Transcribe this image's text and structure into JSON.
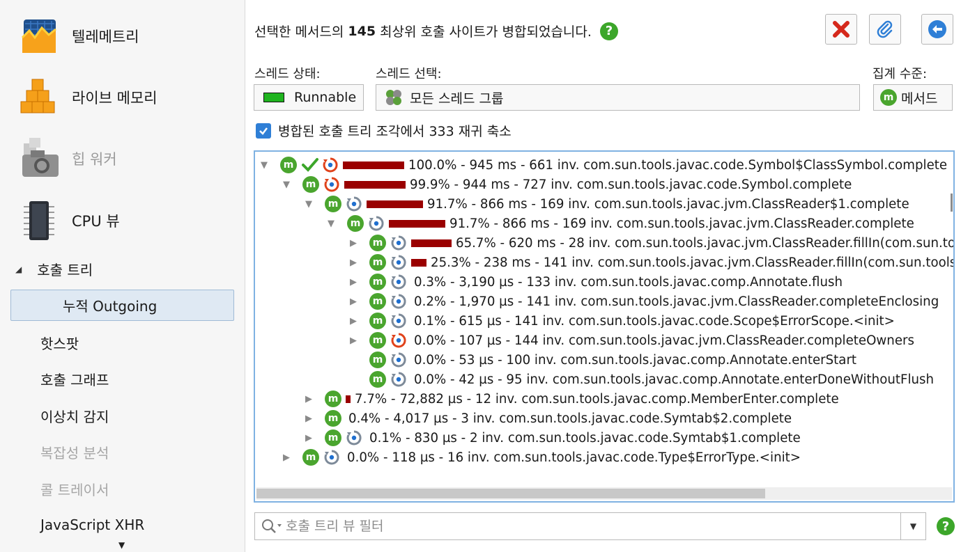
{
  "sidebar": {
    "big_items": [
      {
        "label": "텔레메트리",
        "icon": "telemetry-icon",
        "enabled": true
      },
      {
        "label": "라이브 메모리",
        "icon": "live-memory-icon",
        "enabled": true
      },
      {
        "label": "힙 워커",
        "icon": "heap-walker-icon",
        "enabled": false
      },
      {
        "label": "CPU 뷰",
        "icon": "cpu-view-icon",
        "enabled": true
      }
    ],
    "section": "호출 트리",
    "selected_sub": "누적 Outgoing",
    "items": [
      {
        "label": "핫스팟",
        "enabled": true
      },
      {
        "label": "호출 그래프",
        "enabled": true
      },
      {
        "label": "이상치 감지",
        "enabled": true
      },
      {
        "label": "복잡성 분석",
        "enabled": false
      },
      {
        "label": "콜 트레이서",
        "enabled": false
      },
      {
        "label": "JavaScript XHR",
        "enabled": true
      }
    ]
  },
  "header": {
    "message_before": "선택한 메서드의",
    "message_count": "145",
    "message_after": "최상위 호출 사이트가 병합되었습니다.",
    "help": "?"
  },
  "controls": {
    "thread_state_label": "스레드 상태:",
    "thread_state_value": "Runnable",
    "thread_select_label": "스레드 선택:",
    "thread_select_value": "모든 스레드 그룹",
    "aggregation_label": "집계 수준:",
    "aggregation_value": "메서드",
    "merge_checkbox_label": "병합된 호출 트리 조각에서 333 재귀 축소",
    "merge_checked": true
  },
  "tree": [
    {
      "depth": 0,
      "toggle": "expanded",
      "status": "check",
      "timer": "red",
      "pct": 100.0,
      "text": "100.0% - 945 ms - 661 inv. com.sun.tools.javac.code.Symbol$ClassSymbol.complete"
    },
    {
      "depth": 1,
      "toggle": "expanded",
      "status": "",
      "timer": "red",
      "pct": 99.9,
      "text": "99.9% - 944 ms - 727 inv. com.sun.tools.javac.code.Symbol.complete"
    },
    {
      "depth": 2,
      "toggle": "expanded",
      "status": "",
      "timer": "gray",
      "pct": 91.7,
      "text": "91.7% - 866 ms - 169 inv. com.sun.tools.javac.jvm.ClassReader$1.complete"
    },
    {
      "depth": 3,
      "toggle": "expanded",
      "status": "",
      "timer": "gray",
      "pct": 91.7,
      "text": "91.7% - 866 ms - 169 inv. com.sun.tools.javac.jvm.ClassReader.complete"
    },
    {
      "depth": 4,
      "toggle": "collapsed",
      "status": "",
      "timer": "gray",
      "pct": 65.7,
      "text": "65.7% - 620 ms - 28 inv. com.sun.tools.javac.jvm.ClassReader.fillIn(com.sun.too"
    },
    {
      "depth": 4,
      "toggle": "collapsed",
      "status": "",
      "timer": "gray",
      "pct": 25.3,
      "text": "25.3% - 238 ms - 141 inv. com.sun.tools.javac.jvm.ClassReader.fillIn(com.sun.tools"
    },
    {
      "depth": 4,
      "toggle": "collapsed",
      "status": "",
      "timer": "gray",
      "pct": 0.3,
      "text": "0.3% - 3,190 µs - 133 inv. com.sun.tools.javac.comp.Annotate.flush"
    },
    {
      "depth": 4,
      "toggle": "collapsed",
      "status": "",
      "timer": "gray",
      "pct": 0.2,
      "text": "0.2% - 1,970 µs - 141 inv. com.sun.tools.javac.jvm.ClassReader.completeEnclosing"
    },
    {
      "depth": 4,
      "toggle": "collapsed",
      "status": "",
      "timer": "gray",
      "pct": 0.1,
      "text": "0.1% - 615 µs - 141 inv. com.sun.tools.javac.code.Scope$ErrorScope.<init>"
    },
    {
      "depth": 4,
      "toggle": "collapsed",
      "status": "",
      "timer": "red",
      "pct": 0.0,
      "text": "0.0% - 107 µs - 144 inv. com.sun.tools.javac.jvm.ClassReader.completeOwners"
    },
    {
      "depth": 4,
      "toggle": "none",
      "status": "",
      "timer": "gray",
      "pct": 0.0,
      "text": "0.0% - 53 µs - 100 inv. com.sun.tools.javac.comp.Annotate.enterStart"
    },
    {
      "depth": 4,
      "toggle": "none",
      "status": "",
      "timer": "gray",
      "pct": 0.0,
      "text": "0.0% - 42 µs - 95 inv. com.sun.tools.javac.comp.Annotate.enterDoneWithoutFlush"
    },
    {
      "depth": 2,
      "toggle": "collapsed",
      "status": "",
      "timer": "",
      "pct": 7.7,
      "text": "7.7% - 72,882 µs - 12 inv. com.sun.tools.javac.comp.MemberEnter.complete"
    },
    {
      "depth": 2,
      "toggle": "collapsed",
      "status": "",
      "timer": "",
      "pct": 0.4,
      "text": "0.4% - 4,017 µs - 3 inv. com.sun.tools.javac.code.Symtab$2.complete"
    },
    {
      "depth": 2,
      "toggle": "collapsed",
      "status": "",
      "timer": "gray",
      "pct": 0.1,
      "text": "0.1% - 830 µs - 2 inv. com.sun.tools.javac.code.Symtab$1.complete"
    },
    {
      "depth": 1,
      "toggle": "collapsed",
      "status": "",
      "timer": "gray",
      "pct": 0.0,
      "text": "0.0% - 118 µs - 16 inv. com.sun.tools.javac.code.Type$ErrorType.<init>"
    }
  ],
  "filter": {
    "placeholder": "호출 트리 뷰 필터"
  },
  "colors": {
    "bar": "#9a0000",
    "method_badge": "#4aa52e",
    "accent": "#2f7fd6"
  }
}
